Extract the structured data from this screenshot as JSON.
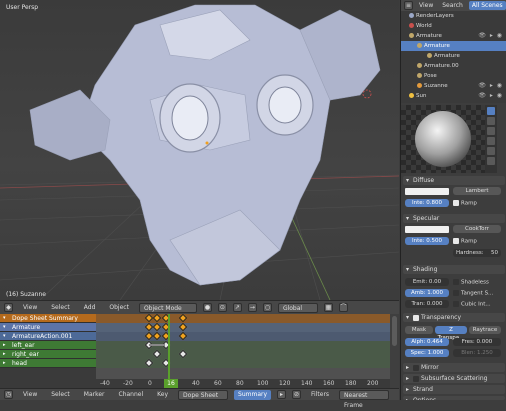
{
  "viewport": {
    "view_label": "User Persp",
    "object_label": "(16) Suzanne"
  },
  "vp_header": {
    "menu": [
      "View",
      "Select",
      "Add",
      "Object"
    ],
    "mode": "Object Mode",
    "orientation": "Global"
  },
  "dopesheet": {
    "channels": [
      {
        "label": "Dope Sheet Summary",
        "kind": "summary"
      },
      {
        "label": "Armature",
        "kind": "object"
      },
      {
        "label": "ArmatureAction.001",
        "kind": "action"
      },
      {
        "label": "left_ear",
        "kind": "group"
      },
      {
        "label": "right_ear",
        "kind": "group"
      },
      {
        "label": "head",
        "kind": "group"
      }
    ],
    "ruler": [
      "-40",
      "-20",
      "0",
      "20",
      "40",
      "60",
      "80",
      "100",
      "120",
      "140",
      "160",
      "180",
      "200"
    ],
    "current_frame": "16"
  },
  "bottom_header": {
    "menu": [
      "View",
      "Select",
      "Marker",
      "Channel",
      "Key"
    ],
    "editor": "Dope Sheet",
    "mode": "Summary",
    "filters": "Filters",
    "snap": "Nearest Frame"
  },
  "outliner": {
    "tabs": [
      "View",
      "Search",
      "All Scenes"
    ],
    "rows": [
      {
        "label": "RenderLayers",
        "indent": 1,
        "color": "#9aa7c7",
        "selected": false
      },
      {
        "label": "World",
        "indent": 1,
        "color": "#c9504c",
        "selected": false
      },
      {
        "label": "Armature",
        "indent": 1,
        "color": "#c0a76a",
        "selected": false
      },
      {
        "label": "Armature",
        "indent": 2,
        "color": "#c0a76a",
        "selected": true
      },
      {
        "label": "Armature",
        "indent": 3,
        "color": "#c0a76a",
        "selected": false
      },
      {
        "label": "Armature.00",
        "indent": 2,
        "color": "#c0a76a",
        "selected": false
      },
      {
        "label": "Pose",
        "indent": 2,
        "color": "#c0a76a",
        "selected": false
      },
      {
        "label": "Suzanne",
        "indent": 2,
        "color": "#e39a3c",
        "selected": false
      },
      {
        "label": "Sun",
        "indent": 1,
        "color": "#f0c040",
        "selected": false
      }
    ]
  },
  "properties": {
    "diffuse": {
      "title": "Diffuse",
      "shader": "Lambert",
      "intensity": "Inte: 0.800",
      "ramp": "Ramp"
    },
    "specular": {
      "title": "Specular",
      "shader": "CookTorr",
      "intensity": "Inte: 0.500",
      "ramp": "Ramp",
      "hardness": "Hardness:",
      "hardness_value": "50"
    },
    "shading": {
      "title": "Shading",
      "emit": "Emit:  0.00",
      "ambient": "Amb: 1.000",
      "translucency": "Tran: 0.000",
      "shadeless": "Shadeless",
      "tangent": "Tangent S...",
      "cubic": "Cubic Int..."
    },
    "transparency": {
      "title": "Transparency",
      "modes": [
        "Mask",
        "Z Transpa...",
        "Raytrace"
      ],
      "alpha": "Alph: 0.464",
      "fresnel": "Fres: 0.000",
      "spec": "Spec: 1.000",
      "blend": "Blen: 1.250"
    },
    "collapsed": [
      "Mirror",
      "Subsurface Scattering",
      "Strand",
      "Options"
    ]
  }
}
